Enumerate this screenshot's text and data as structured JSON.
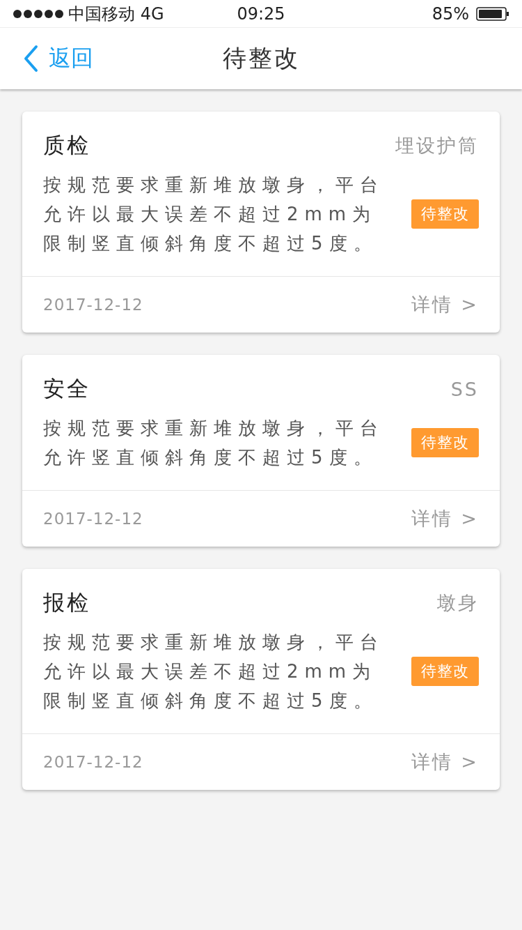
{
  "status_bar": {
    "carrier": "中国移动 4G",
    "time": "09:25",
    "battery": "85%"
  },
  "nav": {
    "back": "返回",
    "title": "待整改"
  },
  "cards": [
    {
      "title": "质检",
      "category": "埋设护筒",
      "description": "按规范要求重新堆放墩身，平台允许以最大误差不超过2mm为限制竖直倾斜角度不超过5度。",
      "status": "待整改",
      "date": "2017-12-12",
      "link": "详情 >"
    },
    {
      "title": "安全",
      "category": "SS",
      "description": "按规范要求重新堆放墩身，平台允许竖直倾斜角度不超过5度。",
      "status": "待整改",
      "date": "2017-12-12",
      "link": "详情 >"
    },
    {
      "title": "报检",
      "category": "墩身",
      "description": "按规范要求重新堆放墩身，平台允许以最大误差不超过2mm为限制竖直倾斜角度不超过5度。",
      "status": "待整改",
      "date": "2017-12-12",
      "link": "详情 >"
    }
  ]
}
